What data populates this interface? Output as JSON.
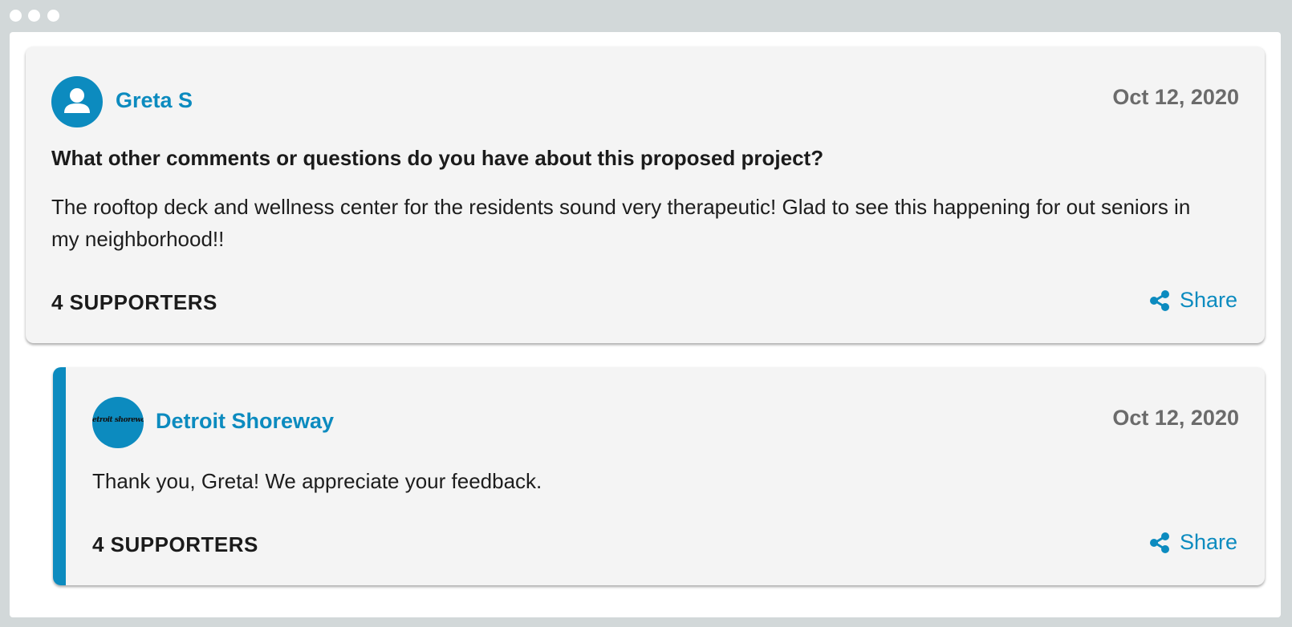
{
  "window": {
    "controls": [
      "close",
      "minimize",
      "maximize"
    ]
  },
  "comment": {
    "author": "Greta S",
    "avatar_icon": "user-icon",
    "date": "Oct 12, 2020",
    "question": "What other comments or questions do you have about this proposed project?",
    "body": "The rooftop deck and wellness center for the residents sound very therapeutic! Glad to see this happening for out seniors in my neighborhood!!",
    "supporters": "4 SUPPORTERS",
    "share_label": "Share",
    "share_icon": "share-icon"
  },
  "reply": {
    "author": "Detroit Shoreway",
    "avatar_text": "etroit shorewa",
    "date": "Oct 12, 2020",
    "body": "Thank you, Greta! We appreciate your feedback.",
    "supporters": "4 SUPPORTERS",
    "share_label": "Share",
    "share_icon": "share-icon"
  },
  "colors": {
    "accent": "#0c8bbf",
    "card_bg": "#f4f4f4",
    "frame": "#d2d8d9",
    "date_text": "#6b6b6b"
  }
}
